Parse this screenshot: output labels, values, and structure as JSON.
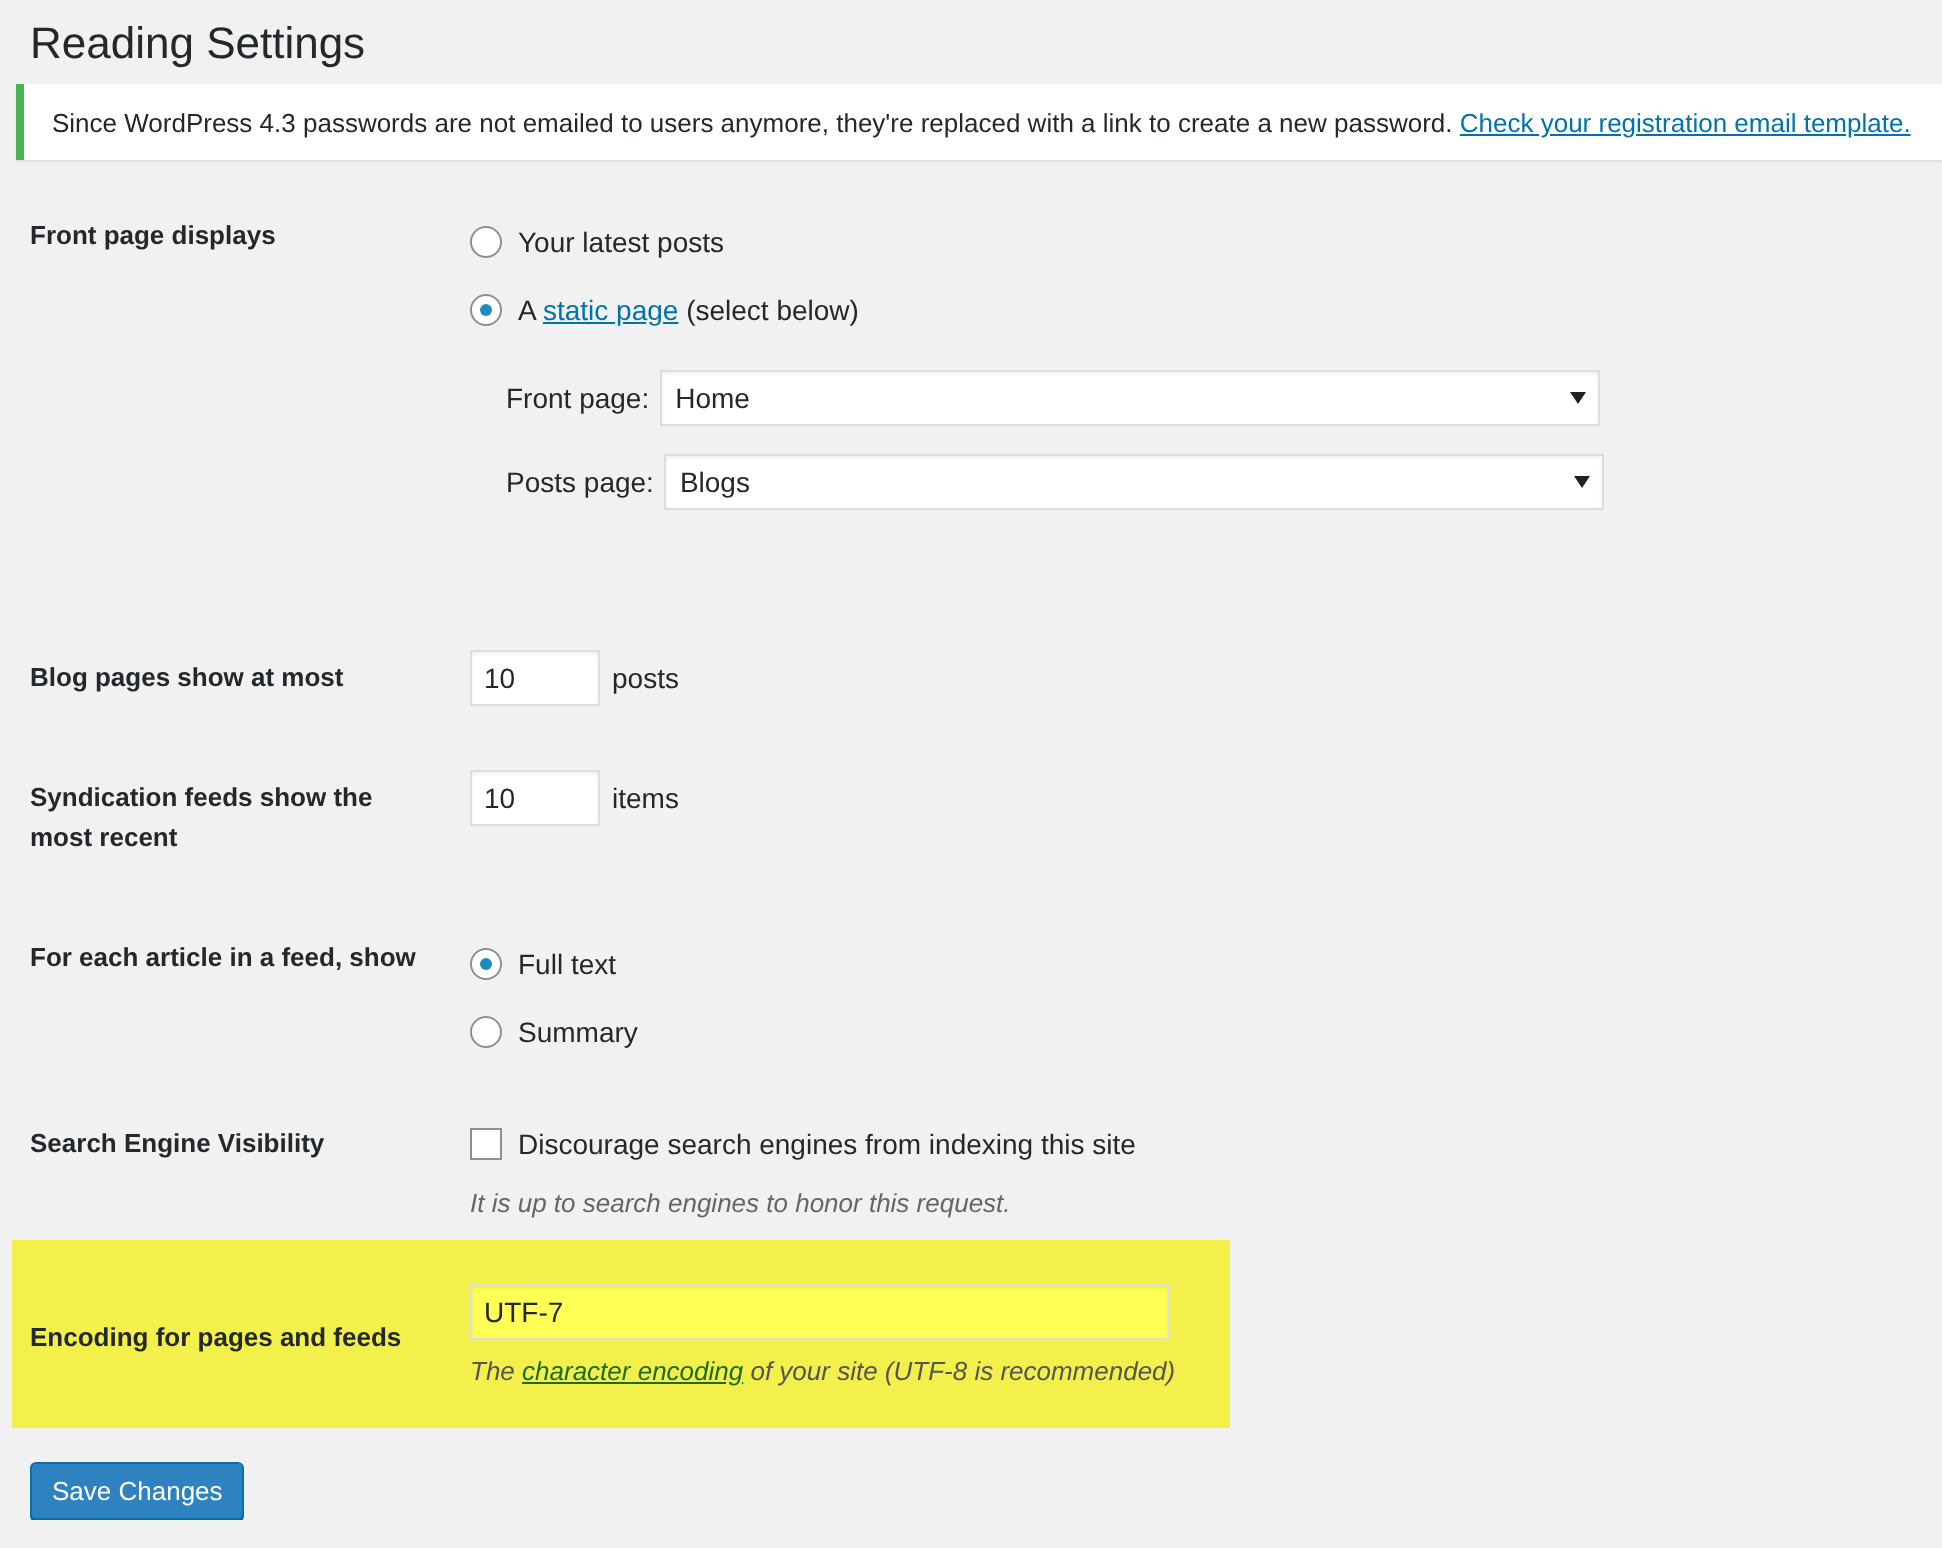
{
  "page": {
    "title": "Reading Settings"
  },
  "notice": {
    "text": "Since WordPress 4.3 passwords are not emailed to users anymore, they're replaced with a link to create a new password.",
    "link": "Check your registration email template."
  },
  "settings": [
    {
      "kind": "radios",
      "label": "Front page displays",
      "options": [
        {
          "text": "Your latest posts",
          "selected": false
        },
        {
          "text": "A",
          "link": "static page",
          "after": "(select below)",
          "selected": true
        }
      ],
      "selects": [
        {
          "label": "Front page:",
          "value": "Home"
        },
        {
          "label": "Posts page:",
          "value": "Blogs"
        }
      ],
      "highlighted": false
    },
    {
      "kind": "number",
      "label": "Blog pages show at most",
      "value": "10",
      "unit": "posts",
      "highlighted": false
    },
    {
      "kind": "number",
      "label": "Syndication feeds show the most recent",
      "value": "10",
      "unit": "items",
      "highlighted": false
    },
    {
      "kind": "radios",
      "label": "For each article in a feed, show",
      "options": [
        {
          "text": "Full text",
          "selected": true
        },
        {
          "text": "Summary",
          "selected": false
        }
      ],
      "highlighted": false
    },
    {
      "kind": "checkbox",
      "label": "Search Engine Visibility",
      "text": "Discourage search engines from indexing this site",
      "checked": false,
      "description": {
        "before": "It is up to search engines to honor this request."
      },
      "highlighted": false
    },
    {
      "kind": "text",
      "label": "Encoding for pages and feeds",
      "value": "UTF-7",
      "description": {
        "before": "The",
        "link": "character encoding",
        "after": "of your site (UTF-8 is recommended)"
      },
      "highlighted": true
    }
  ],
  "submit": {
    "label": "Save Changes"
  }
}
